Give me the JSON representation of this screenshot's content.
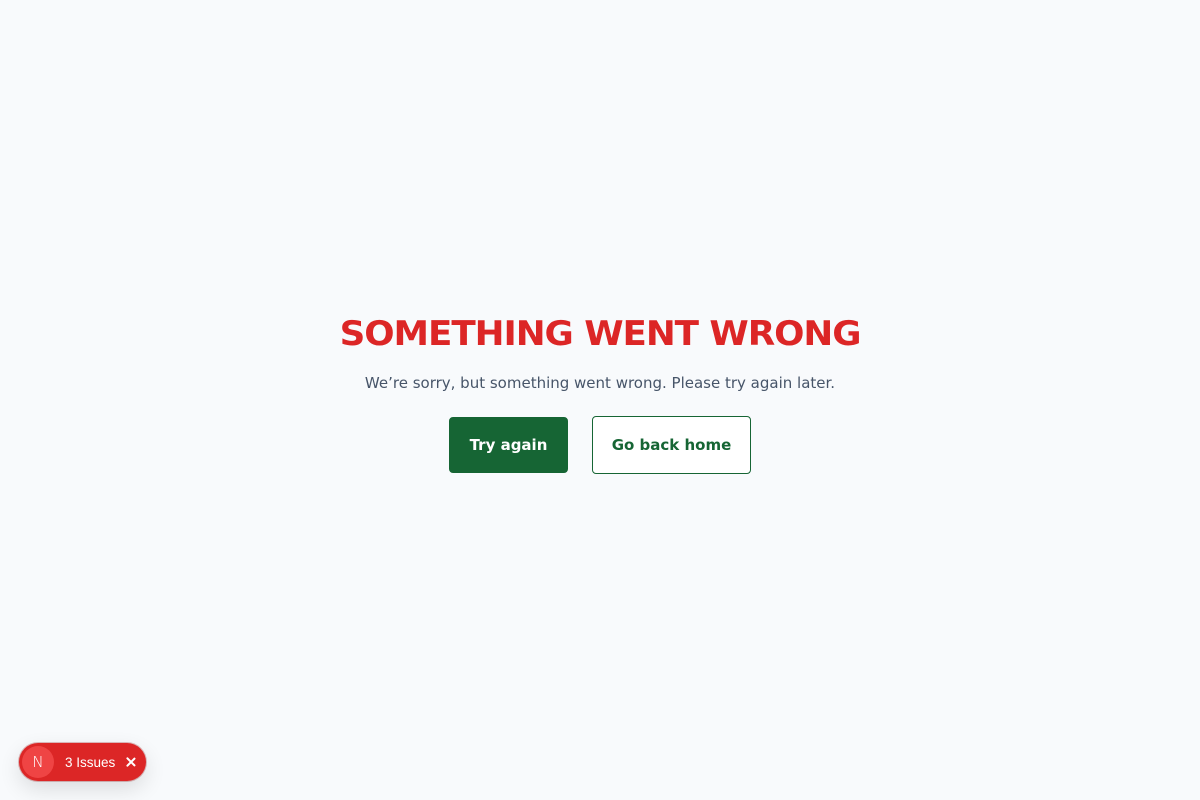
{
  "error": {
    "title": "Something went wrong",
    "message": "We’re sorry, but something went wrong. Please try again later."
  },
  "actions": {
    "retry_label": "Try again",
    "home_label": "Go back home"
  },
  "dev_overlay": {
    "logo_letter": "N",
    "issues_label": "3 Issues",
    "close_icon": "close-icon"
  },
  "colors": {
    "title": "#dc2626",
    "primary": "#166534",
    "badge": "#dc2626",
    "background": "#f8fafc"
  }
}
